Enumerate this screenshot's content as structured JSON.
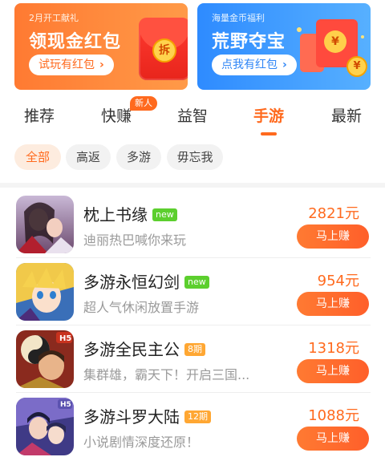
{
  "banners": {
    "left": {
      "small": "2月开工献礼",
      "title": "领现金红包",
      "button": "试玩有红包",
      "chevron": "›",
      "coin_char": "拆"
    },
    "right": {
      "small": "海量金币福利",
      "title": "荒野夺宝",
      "button": "点我有红包",
      "chevron": "›",
      "coin_char": "¥"
    }
  },
  "tabs": [
    {
      "label": "推荐",
      "active": false
    },
    {
      "label": "快赚",
      "active": false,
      "badge": "新人"
    },
    {
      "label": "益智",
      "active": false
    },
    {
      "label": "手游",
      "active": true
    },
    {
      "label": "最新",
      "active": false
    }
  ],
  "filters": [
    {
      "label": "全部",
      "active": true
    },
    {
      "label": "高返",
      "active": false
    },
    {
      "label": "多游",
      "active": false
    },
    {
      "label": "毋忘我",
      "active": false
    }
  ],
  "games": [
    {
      "title": "枕上书缘",
      "tag": "new",
      "tag_color": "#5ccf2e",
      "desc": "迪丽热巴喊你来玩",
      "price": "2821元",
      "button": "马上赚",
      "icon": "game-icon-zhenshangshuyuan"
    },
    {
      "title": "多游永恒幻剑",
      "tag": "new",
      "tag_color": "#5ccf2e",
      "desc": "超人气休闲放置手游",
      "price": "954元",
      "button": "马上赚",
      "icon": "game-icon-yonghenghuanjian"
    },
    {
      "title": "多游全民主公",
      "tag": "8期",
      "tag_color": "#ffa733",
      "desc": "集群雄，霸天下！开启三国...",
      "price": "1318元",
      "button": "马上赚",
      "icon": "game-icon-quanminzhugong"
    },
    {
      "title": "多游斗罗大陆",
      "tag": "12期",
      "tag_color": "#ffa733",
      "desc": "小说剧情深度还原！",
      "price": "1088元",
      "button": "马上赚",
      "icon": "game-icon-douluodalu"
    }
  ],
  "colors": {
    "accent": "#ff6a1e",
    "banner_left": "#ff7a32",
    "banner_right": "#2e8bff"
  }
}
